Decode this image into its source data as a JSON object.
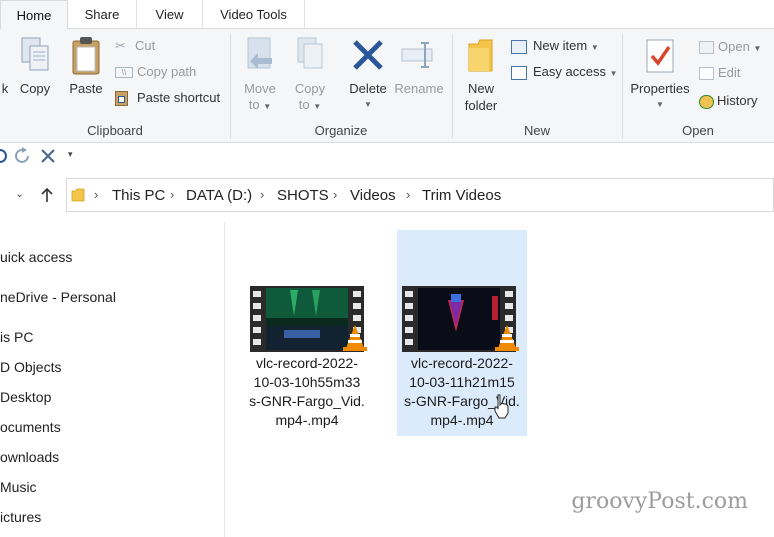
{
  "tabs": [
    "Home",
    "Share",
    "View",
    "Video Tools"
  ],
  "ribbon": {
    "clipboard": {
      "pin_partial": "k",
      "copy": "Copy",
      "paste": "Paste",
      "cut": "Cut",
      "copy_path": "Copy path",
      "paste_shortcut": "Paste shortcut",
      "label": "Clipboard"
    },
    "organize": {
      "move_to_1": "Move",
      "move_to_2": "to",
      "copy_to_1": "Copy",
      "copy_to_2": "to",
      "delete": "Delete",
      "rename": "Rename",
      "label": "Organize"
    },
    "new": {
      "new_folder_1": "New",
      "new_folder_2": "folder",
      "new_item": "New item",
      "easy_access": "Easy access",
      "label": "New"
    },
    "open": {
      "properties": "Properties",
      "open": "Open",
      "edit": "Edit",
      "history": "History",
      "label": "Open"
    }
  },
  "address": {
    "crumbs": [
      "This PC",
      "DATA (D:)",
      "SHOTS",
      "Videos",
      "Trim Videos"
    ]
  },
  "nav": [
    "uick access",
    "neDrive - Personal",
    "is PC",
    "D Objects",
    "Desktop",
    "ocuments",
    "ownloads",
    "Music",
    "ictures"
  ],
  "files": [
    {
      "name_lines": [
        "vlc-record-2022-",
        "10-03-10h55m33",
        "s-GNR-Fargo_Vid.",
        "mp4-.mp4"
      ],
      "selected": false
    },
    {
      "name_lines": [
        "vlc-record-2022-",
        "10-03-11h21m15",
        "s-GNR-Fargo_Vid.",
        "mp4-.mp4"
      ],
      "selected": true
    }
  ],
  "watermark": "groovyPost.com",
  "colors": {
    "selection": "#dcebfc",
    "ribbon_bg": "#f5f6f7",
    "delete_x": "#2b579a",
    "vlc_orange": "#f08a00"
  }
}
